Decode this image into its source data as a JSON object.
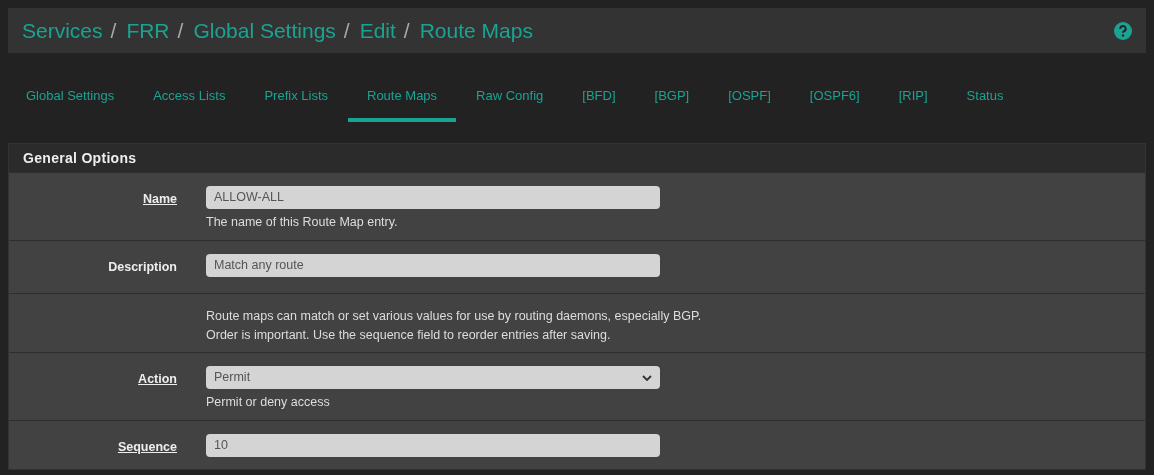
{
  "breadcrumb": [
    "Services",
    "FRR",
    "Global Settings",
    "Edit",
    "Route Maps"
  ],
  "breadcrumb_separator": "/",
  "tabs": [
    {
      "label": "Global Settings",
      "selected": false
    },
    {
      "label": "Access Lists",
      "selected": false
    },
    {
      "label": "Prefix Lists",
      "selected": false
    },
    {
      "label": "Route Maps",
      "selected": true
    },
    {
      "label": "Raw Config",
      "selected": false
    },
    {
      "label": "[BFD]",
      "selected": false
    },
    {
      "label": "[BGP]",
      "selected": false
    },
    {
      "label": "[OSPF]",
      "selected": false
    },
    {
      "label": "[OSPF6]",
      "selected": false
    },
    {
      "label": "[RIP]",
      "selected": false
    },
    {
      "label": "Status",
      "selected": false
    }
  ],
  "panel": {
    "title": "General Options",
    "rows": [
      {
        "kind": "input",
        "label": "Name",
        "required": true,
        "value": "ALLOW-ALL",
        "help": [
          "The name of this Route Map entry."
        ]
      },
      {
        "kind": "input",
        "label": "Description",
        "required": false,
        "value": "Match any route"
      },
      {
        "kind": "note",
        "help": [
          "Route maps can match or set various values for use by routing daemons, especially BGP.",
          "Order is important. Use the sequence field to reorder entries after saving."
        ]
      },
      {
        "kind": "select",
        "label": "Action",
        "required": true,
        "value": "Permit",
        "help": [
          "Permit or deny access"
        ]
      },
      {
        "kind": "input",
        "label": "Sequence",
        "required": true,
        "value": "10"
      }
    ]
  }
}
